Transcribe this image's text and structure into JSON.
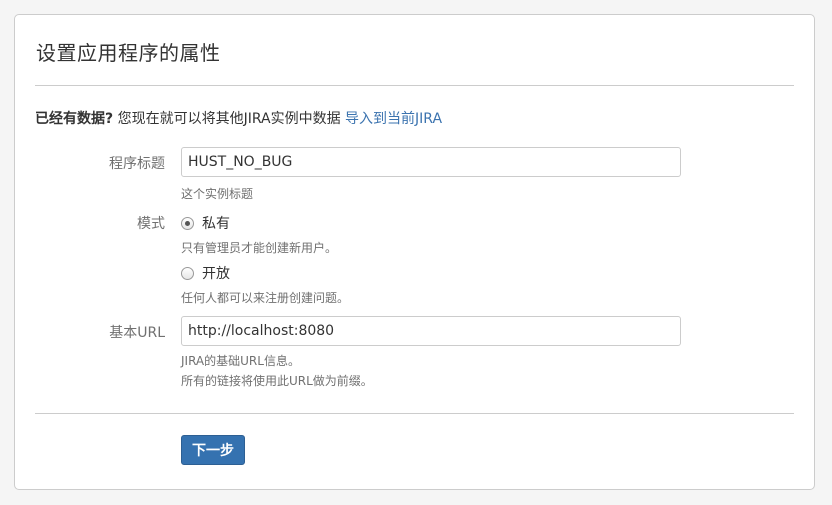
{
  "page_title": "设置应用程序的属性",
  "import": {
    "question": "已经有数据?",
    "text": " 您现在就可以将其他JIRA实例中数据 ",
    "link": "导入到当前JIRA"
  },
  "app_title": {
    "label": "程序标题",
    "value": "HUST_NO_BUG",
    "help": "这个实例标题"
  },
  "mode": {
    "label": "模式",
    "options": [
      {
        "label": "私有",
        "help": "只有管理员才能创建新用户。",
        "checked": true
      },
      {
        "label": "开放",
        "help": "任何人都可以来注册创建问题。",
        "checked": false
      }
    ]
  },
  "base_url": {
    "label": "基本URL",
    "value": "http://localhost:8080",
    "help_line1": "JIRA的基础URL信息。",
    "help_line2": "所有的链接将使用此URL做为前缀。"
  },
  "next_button": "下一步",
  "colors": {
    "link": "#3b73af",
    "button": "#3572b0",
    "help_text": "#707070"
  }
}
